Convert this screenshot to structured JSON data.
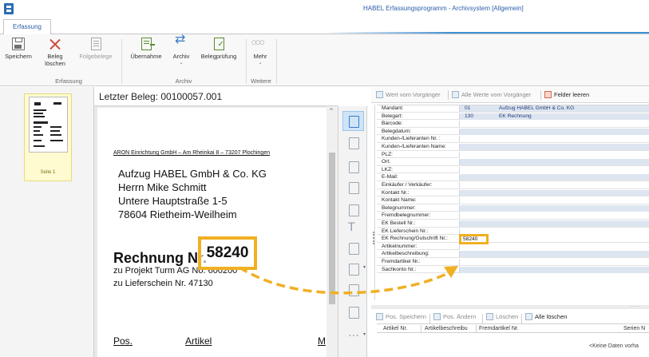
{
  "app": {
    "title": "HABEL Erfassungsprogramm - Archivsystem [Allgemein]"
  },
  "ribbon": {
    "tab": "Erfassung",
    "buttons": {
      "save": "Speichern",
      "delete_line1": "Beleg",
      "delete_line2": "löschen",
      "follow_docs": "Folgebelege",
      "takeover": "Übernahme",
      "archive": "Archiv",
      "doc_check": "Belegprüfung",
      "more": "Mehr"
    },
    "groups": {
      "capture": "Erfassung",
      "archive": "Archiv",
      "more": "Weitere"
    }
  },
  "thumbnails": {
    "page_label": "Seite 1"
  },
  "viewer": {
    "last_doc": "Letzter Beleg: 00100057.001",
    "sender_line": "ARON Einrichtung GmbH – Am Rheinkai 8 – 73207 Plochingen",
    "address": [
      "Aufzug HABEL GmbH & Co. KG",
      "Herrn Mike Schmitt",
      "Untere Hauptstraße 1-5",
      "78604 Rietheim-Weilheim"
    ],
    "invoice_title": "Rechnung Nr.",
    "invoice_number": "58240",
    "project_line": "zu Projekt Turm AG No. 600200",
    "delivery_line": "zu Lieferschein Nr. 47130",
    "table_headers": {
      "pos": "Pos.",
      "article": "Artikel",
      "cut": "M"
    }
  },
  "form_toolbar": {
    "value_prev": "Wert vom Vorgänger",
    "all_values_prev": "Alle Werte vom Vorgänger",
    "clear_fields": "Felder leeren"
  },
  "form": {
    "mandant": {
      "label": "Mandant:",
      "code": "01",
      "desc": "Aufzug HABEL GmbH & Co. KG"
    },
    "belegart": {
      "label": "Belegart:",
      "code": "130",
      "desc": "EK Rechnung"
    },
    "labels": [
      "Barcode:",
      "Belegdatum:",
      "Kunden-/Lieferanten Nr. :",
      "Kunden-/Lieferanten Name:",
      "PLZ:",
      "Ort:",
      "LKZ:",
      "E-Mail:",
      "Einkäufer / Verkäufer:",
      "Kontakt Nr.:",
      "Kontakt Name:",
      "Belegnummer:",
      "Fremdbelegnummer:",
      "EK Bestell Nr.:",
      "EK Lieferschein Nr.:",
      "EK Rechnung/Gutschrift Nr.:",
      "Artikelnummer:",
      "Artikelbeschreibung:",
      "Fremdartikel Nr.:",
      "Sachkonto Nr.:"
    ],
    "invoice_input_value": "58240"
  },
  "positions": {
    "toolbar": {
      "save": "Pos. Speichern",
      "edit": "Pos. Ändern",
      "delete": "Löschen",
      "delete_all": "Alle löschen"
    },
    "columns": [
      "Artikel Nr.",
      "Artikelbeschreibu",
      "Fremdartikel Nr.",
      "Serien N"
    ],
    "empty_text": "<Keine Daten vorha"
  },
  "colors": {
    "accent_blue": "#3c8fd6",
    "highlight_orange": "#f0b023",
    "field_blue": "#dde5f0",
    "thumb_yellow": "#fffbd0"
  }
}
